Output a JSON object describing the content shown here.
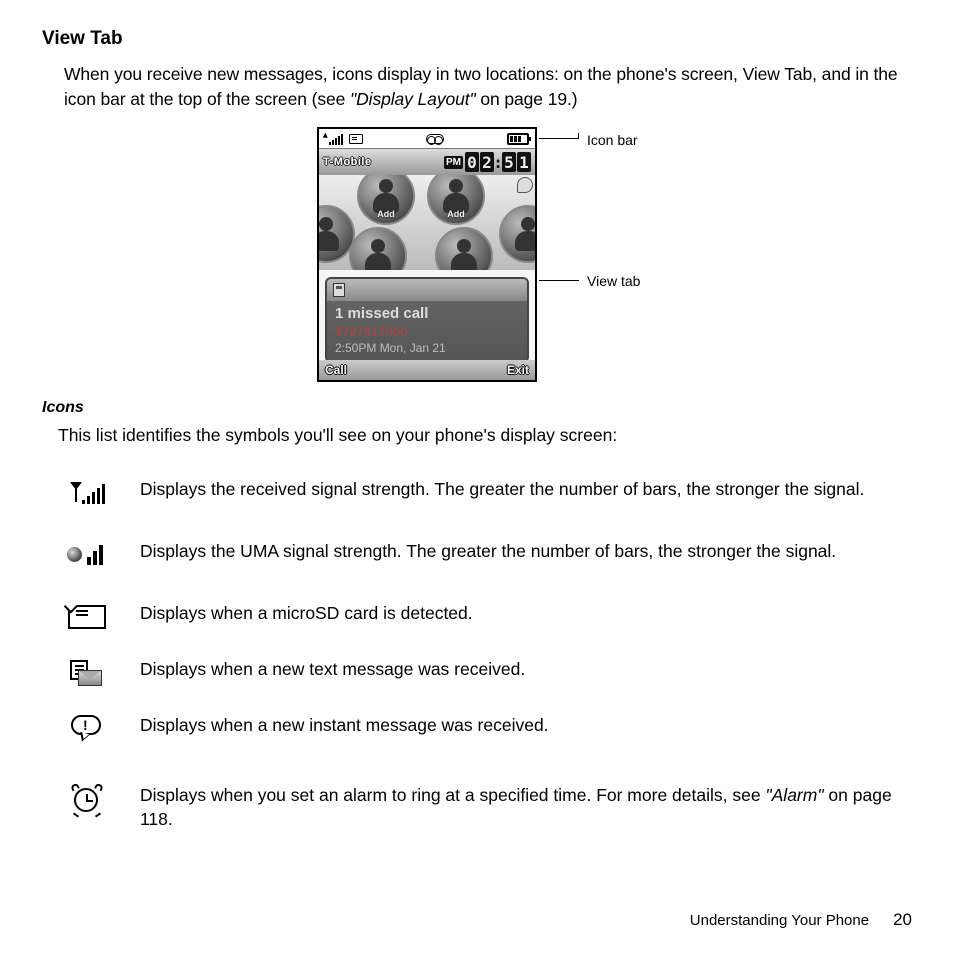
{
  "section": {
    "title": "View Tab",
    "intro_pre": "When you receive new messages, icons display in two locations: on the phone's screen, View Tab, and in the icon bar at the top of the screen (see ",
    "intro_ref": "\"Display Layout\"",
    "intro_post": " on page 19.)"
  },
  "callouts": {
    "icon_bar": "Icon bar",
    "view_tab": "View tab"
  },
  "phone": {
    "carrier": "T-Mobile",
    "clock_ampm": "PM",
    "clock_digits": [
      "0",
      "2",
      ":",
      "5",
      "1"
    ],
    "add_label": "Add",
    "notification": {
      "title": "1 missed call",
      "number": "9727617000",
      "time": "2:50PM Mon, Jan 21"
    },
    "softkey_left": "Call",
    "softkey_right": "Exit"
  },
  "icons_section": {
    "title": "Icons",
    "intro": "This list identifies the symbols you'll see on your phone's display screen:"
  },
  "icons": [
    {
      "name": "signal-strength-icon",
      "desc": "Displays the received signal strength. The greater the number of bars, the stronger the signal."
    },
    {
      "name": "uma-signal-icon",
      "desc": "Displays the UMA signal strength. The greater the number of bars, the stronger the signal."
    },
    {
      "name": "microsd-icon",
      "desc": "Displays when a microSD card is detected."
    },
    {
      "name": "text-message-icon",
      "desc": "Displays when a new text message was received."
    },
    {
      "name": "instant-message-icon",
      "desc": "Displays when a new instant message was received."
    },
    {
      "name": "alarm-icon",
      "desc_pre": "Displays when you set an alarm to ring at a specified time. For more details, see ",
      "desc_ref": "\"Alarm\"",
      "desc_post": " on page 118."
    }
  ],
  "footer": {
    "chapter": "Understanding Your Phone",
    "page": "20"
  }
}
